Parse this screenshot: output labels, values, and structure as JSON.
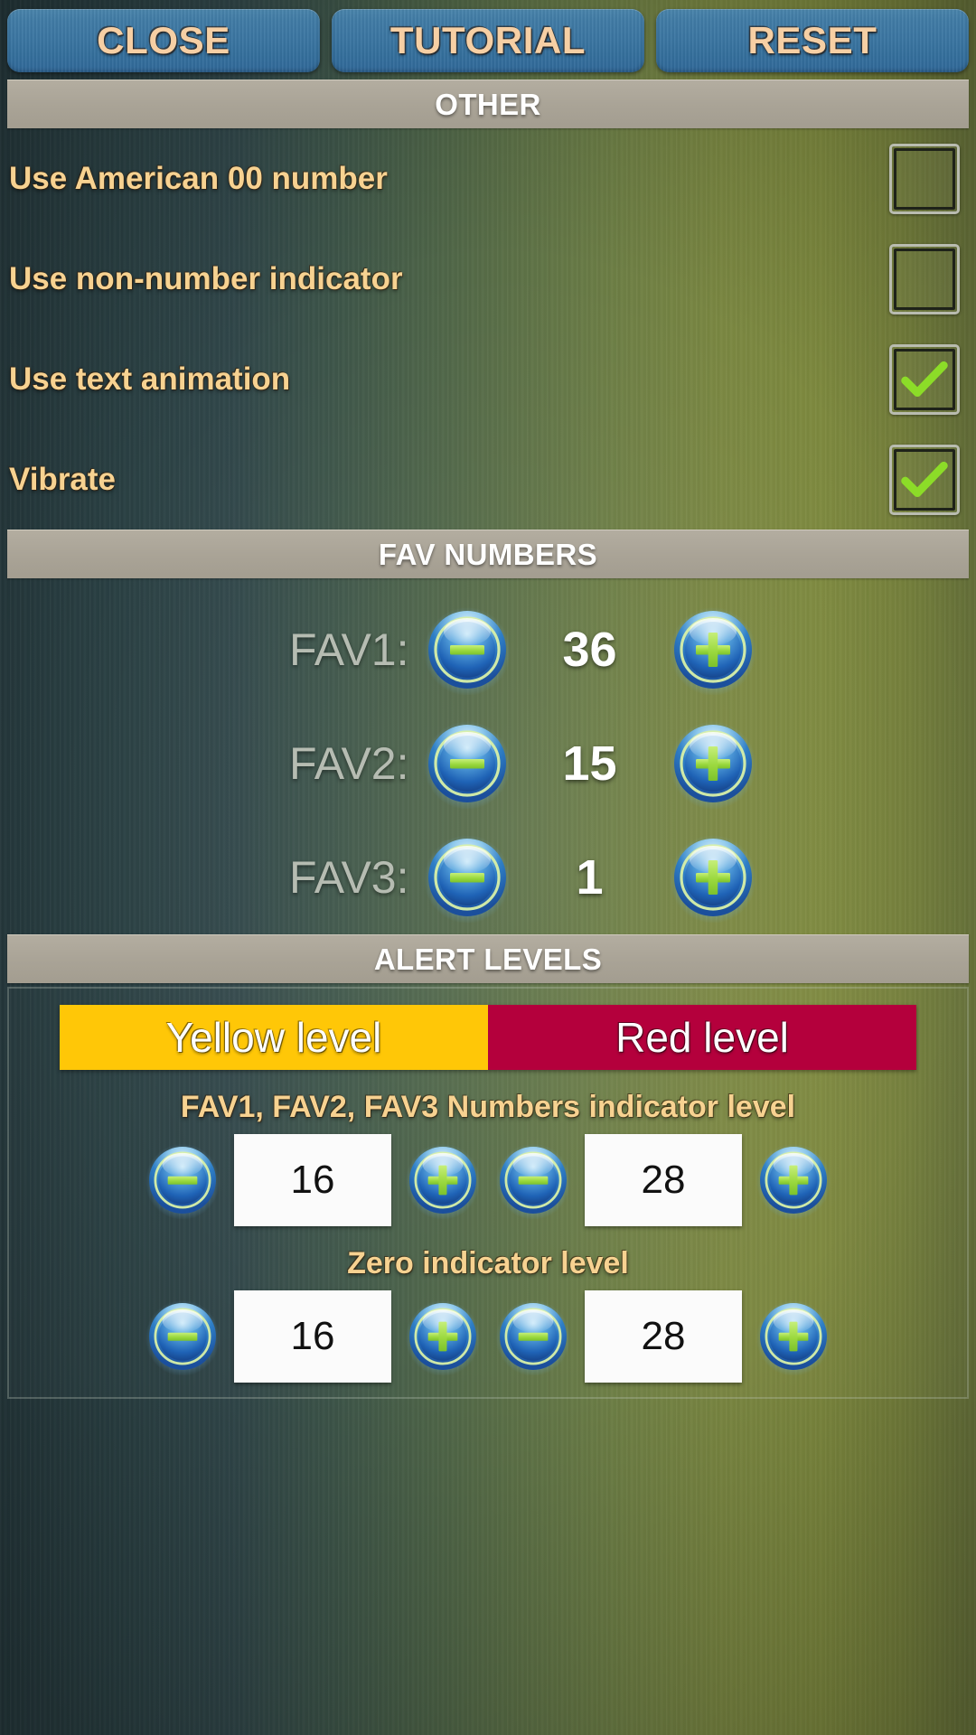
{
  "topbar": {
    "buttons": [
      {
        "label": "CLOSE",
        "name": "close-button"
      },
      {
        "label": "TUTORIAL",
        "name": "tutorial-button"
      },
      {
        "label": "RESET",
        "name": "reset-button"
      }
    ]
  },
  "sections": {
    "other": {
      "title": "OTHER"
    },
    "fav": {
      "title": "FAV NUMBERS"
    },
    "alert": {
      "title": "ALERT LEVELS"
    }
  },
  "options": [
    {
      "label": "Use American 00 number",
      "checked": false
    },
    {
      "label": "Use non-number indicator",
      "checked": false
    },
    {
      "label": "Use text animation",
      "checked": true
    },
    {
      "label": "Vibrate",
      "checked": true
    }
  ],
  "fav_numbers": [
    {
      "label": "FAV1:",
      "value": "36"
    },
    {
      "label": "FAV2:",
      "value": "15"
    },
    {
      "label": "FAV3:",
      "value": "1"
    }
  ],
  "alert_levels": {
    "yellow_label": "Yellow level",
    "red_label": "Red level",
    "groups": [
      {
        "title": "FAV1, FAV2, FAV3 Numbers indicator level",
        "yellow_value": "16",
        "red_value": "28"
      },
      {
        "title": "Zero indicator level",
        "yellow_value": "16",
        "red_value": "28"
      }
    ]
  },
  "icons": {
    "minus": "minus-icon",
    "plus": "plus-icon",
    "check": "check-icon"
  },
  "colors": {
    "button_blue": "#3b76a2",
    "button_text": "#f6cfa4",
    "label_gold": "#f7d291",
    "section_bar": "#a9a396",
    "yellow_level": "#ffc707",
    "red_level": "#b4003c",
    "check_green": "#8cdc28",
    "fav_label_gray": "#b6bcb2"
  }
}
